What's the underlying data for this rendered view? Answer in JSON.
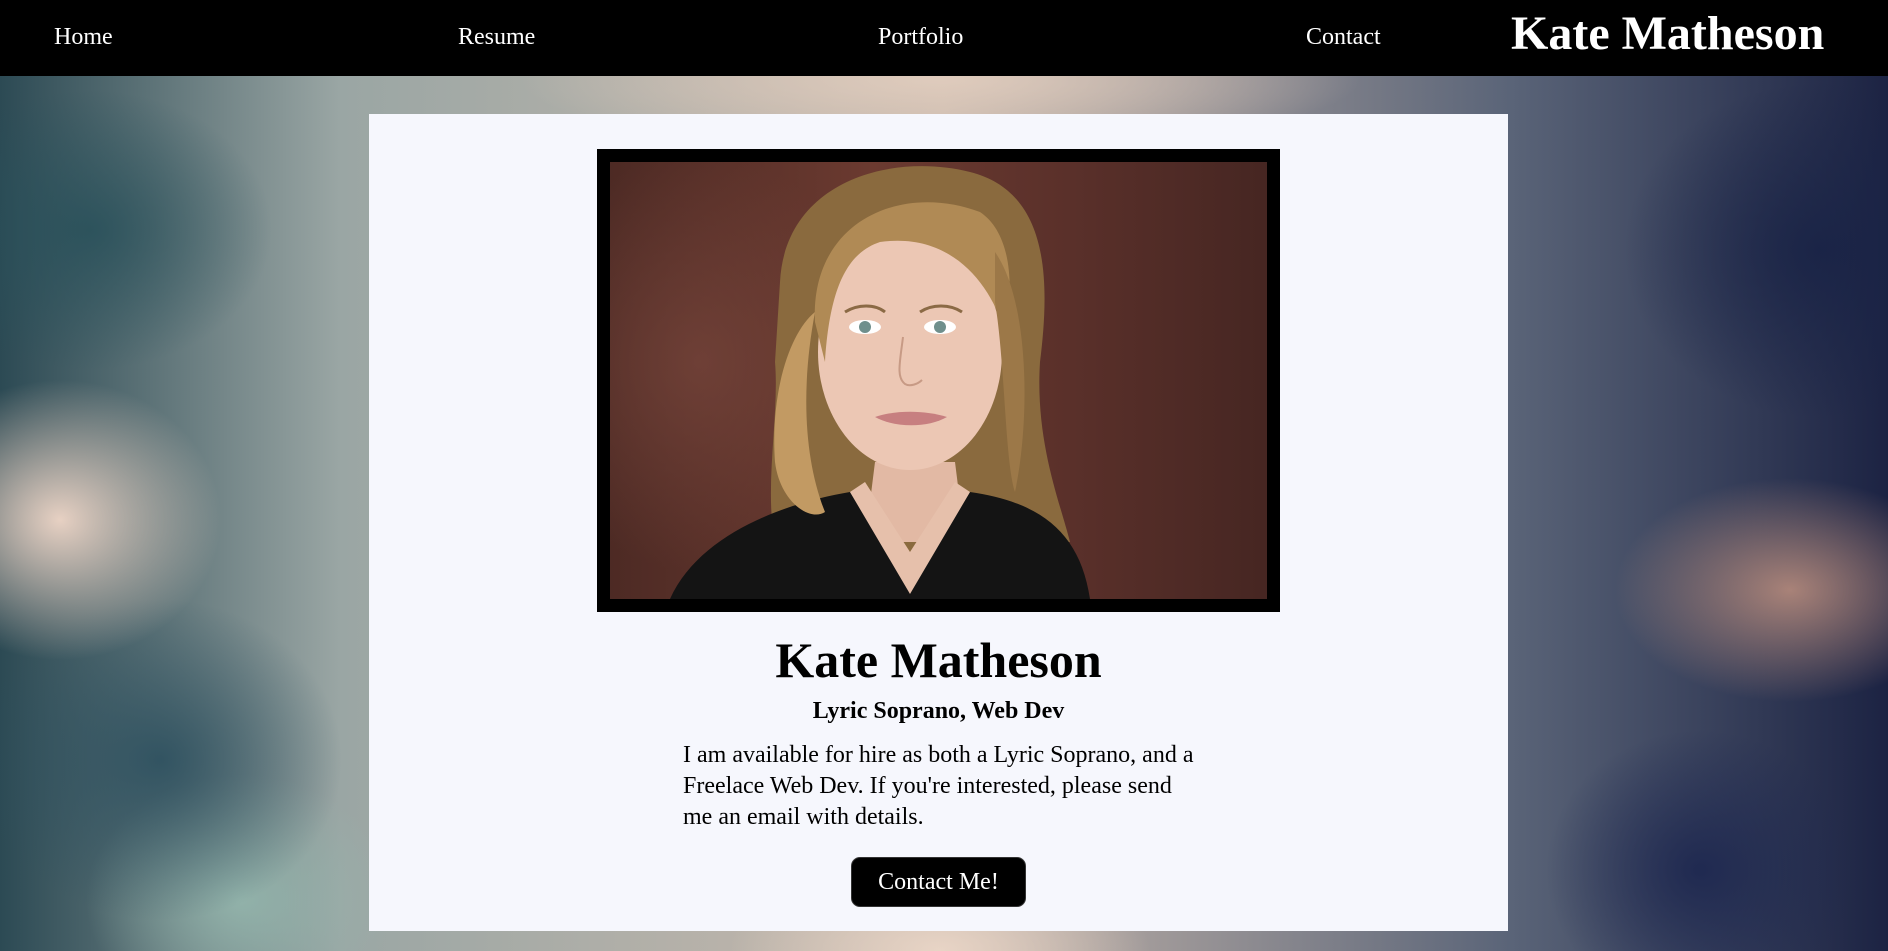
{
  "nav": {
    "items": [
      {
        "label": "Home"
      },
      {
        "label": "Resume"
      },
      {
        "label": "Portfolio"
      },
      {
        "label": "Contact"
      }
    ],
    "brand": "Kate Matheson"
  },
  "profile": {
    "name": "Kate Matheson",
    "subtitle": "Lyric Soprano, Web Dev",
    "bio": "I am available for hire as both a Lyric Soprano, and a Freelace Web Dev. If you're interested, please send me an email with details.",
    "cta_label": "Contact Me!"
  },
  "colors": {
    "nav_bg": "#000000",
    "card_bg": "#f6f7fd",
    "button_bg": "#000000"
  }
}
